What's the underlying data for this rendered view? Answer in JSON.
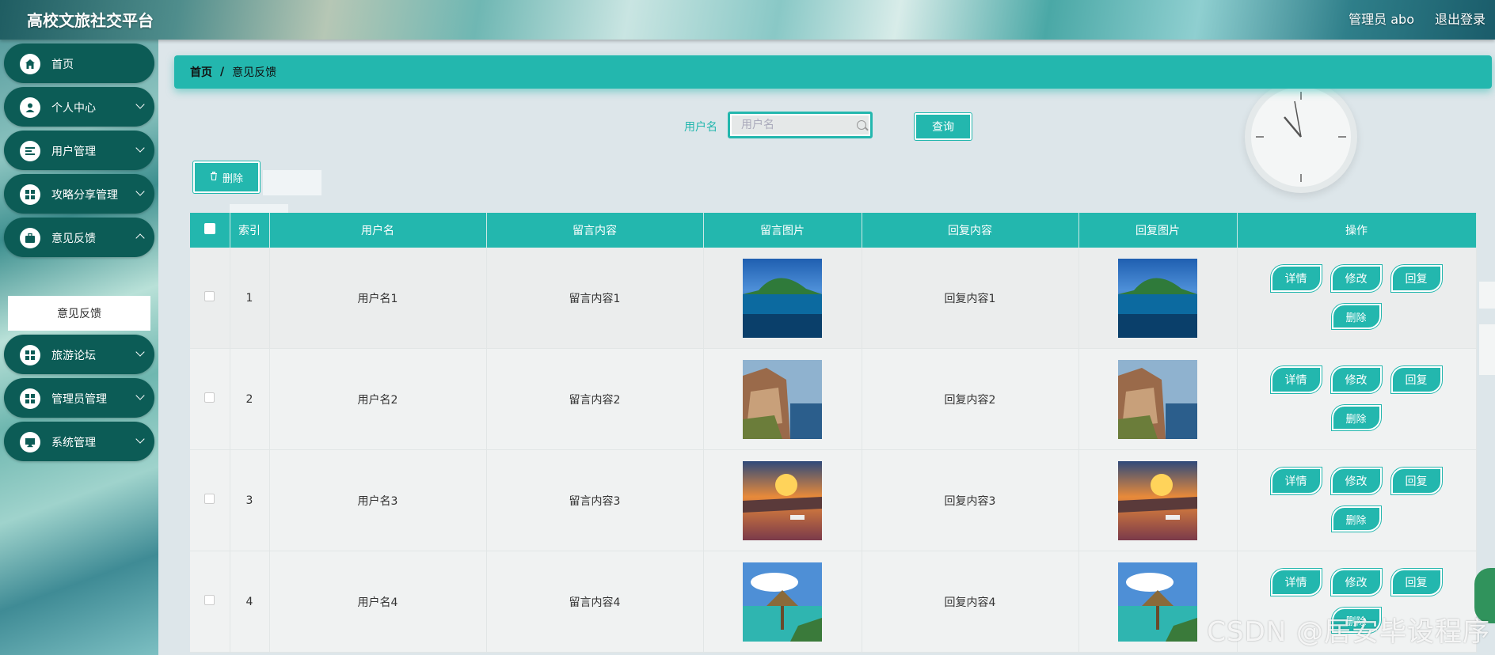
{
  "header": {
    "title": "高校文旅社交平台",
    "admin": "管理员 abo",
    "logout": "退出登录"
  },
  "sidebar": {
    "items": [
      {
        "label": "首页",
        "icon": "home-icon"
      },
      {
        "label": "个人中心",
        "icon": "user-icon"
      },
      {
        "label": "用户管理",
        "icon": "list-icon"
      },
      {
        "label": "攻略分享管理",
        "icon": "grid-icon"
      },
      {
        "label": "意见反馈",
        "icon": "briefcase-icon"
      },
      {
        "label": "旅游论坛",
        "icon": "grid-icon"
      },
      {
        "label": "管理员管理",
        "icon": "grid-icon"
      },
      {
        "label": "系统管理",
        "icon": "monitor-icon"
      }
    ],
    "submenu": {
      "label": "意见反馈"
    }
  },
  "breadcrumb": {
    "home": "首页",
    "sep": "/",
    "current": "意见反馈"
  },
  "search": {
    "label": "用户名",
    "placeholder": "用户名",
    "button": "查询"
  },
  "toolbar": {
    "delete_label": "删除"
  },
  "table": {
    "columns": [
      "索引",
      "用户名",
      "留言内容",
      "留言图片",
      "回复内容",
      "回复图片",
      "操作"
    ],
    "rows": [
      {
        "index": "1",
        "username": "用户名1",
        "message": "留言内容1",
        "reply": "回复内容1"
      },
      {
        "index": "2",
        "username": "用户名2",
        "message": "留言内容2",
        "reply": "回复内容2"
      },
      {
        "index": "3",
        "username": "用户名3",
        "message": "留言内容3",
        "reply": "回复内容3"
      },
      {
        "index": "4",
        "username": "用户名4",
        "message": "留言内容4",
        "reply": "回复内容4"
      }
    ],
    "actions": {
      "detail": "详情",
      "edit": "修改",
      "reply": "回复",
      "delete": "删除"
    }
  },
  "watermark": "CSDN @居安毕设程序",
  "colors": {
    "accent": "#23b7ae",
    "sidebar_item": "#0c5c56"
  }
}
